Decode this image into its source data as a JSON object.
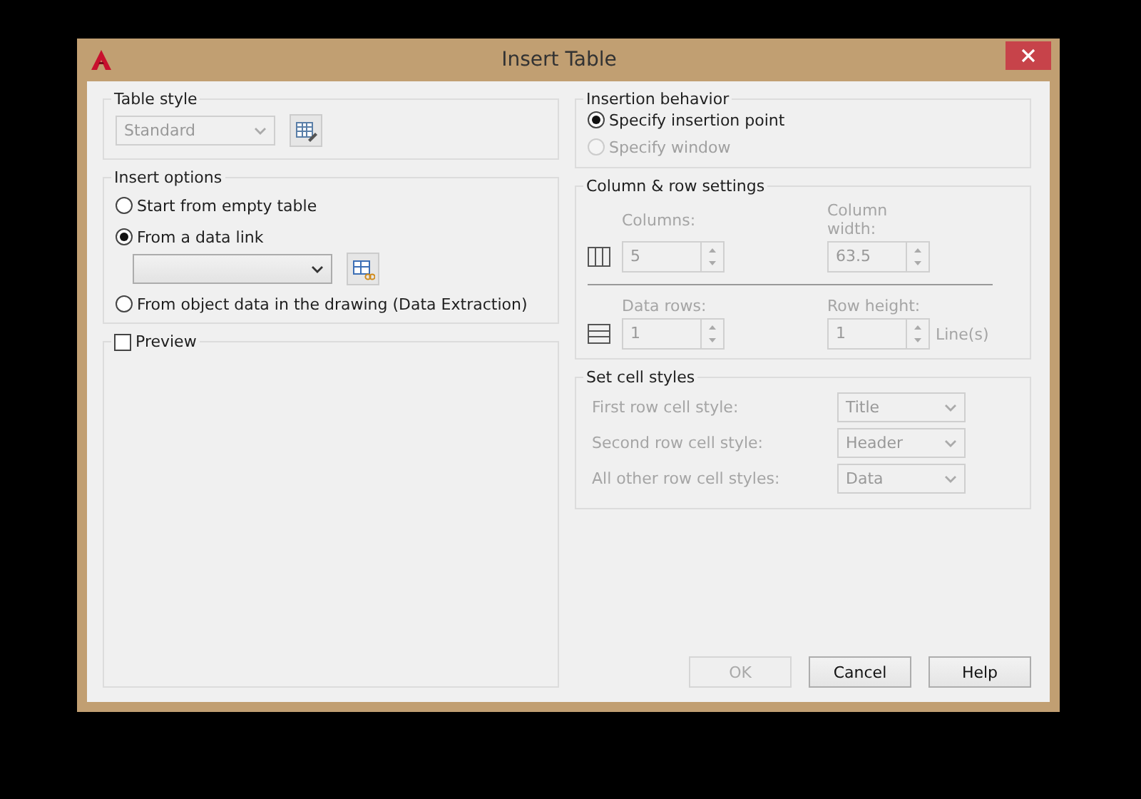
{
  "window": {
    "title": "Insert Table"
  },
  "table_style": {
    "legend": "Table style",
    "value": "Standard",
    "disabled": true
  },
  "insert_options": {
    "legend": "Insert options",
    "options": [
      {
        "kind": "radio",
        "label": "Start from empty table",
        "selected": false
      },
      {
        "kind": "radio",
        "label": "From a data link",
        "selected": true
      },
      {
        "kind": "link",
        "disabled": false
      },
      {
        "kind": "radio",
        "label": "From object data in the drawing (Data Extraction)",
        "selected": false
      }
    ]
  },
  "preview": {
    "label": "Preview",
    "checked": false
  },
  "insertion_behavior": {
    "legend": "Insertion behavior",
    "options": [
      {
        "label": "Specify insertion point",
        "selected": true,
        "disabled": false
      },
      {
        "label": "Specify window",
        "selected": false,
        "disabled": true
      }
    ]
  },
  "column_row_settings": {
    "legend": "Column & row settings",
    "rows": [
      {
        "kind": "columns",
        "fields": [
          {
            "label": "Columns:",
            "value": "5"
          },
          {
            "label": "Column width:",
            "value": "63.5"
          }
        ]
      },
      {
        "kind": "rows",
        "fields": [
          {
            "label": "Data rows:",
            "value": "1"
          },
          {
            "label": "Row height:",
            "value": "1",
            "unit": "Line(s)"
          }
        ]
      }
    ]
  },
  "cell_styles": {
    "legend": "Set cell styles",
    "rows": [
      {
        "label": "First row cell style:",
        "value": "Title"
      },
      {
        "label": "Second row cell style:",
        "value": "Header"
      },
      {
        "label": "All other row cell styles:",
        "value": "Data"
      }
    ]
  },
  "buttons": [
    {
      "label": "OK",
      "disabled": true
    },
    {
      "label": "Cancel",
      "disabled": false
    },
    {
      "label": "Help",
      "disabled": false
    }
  ]
}
